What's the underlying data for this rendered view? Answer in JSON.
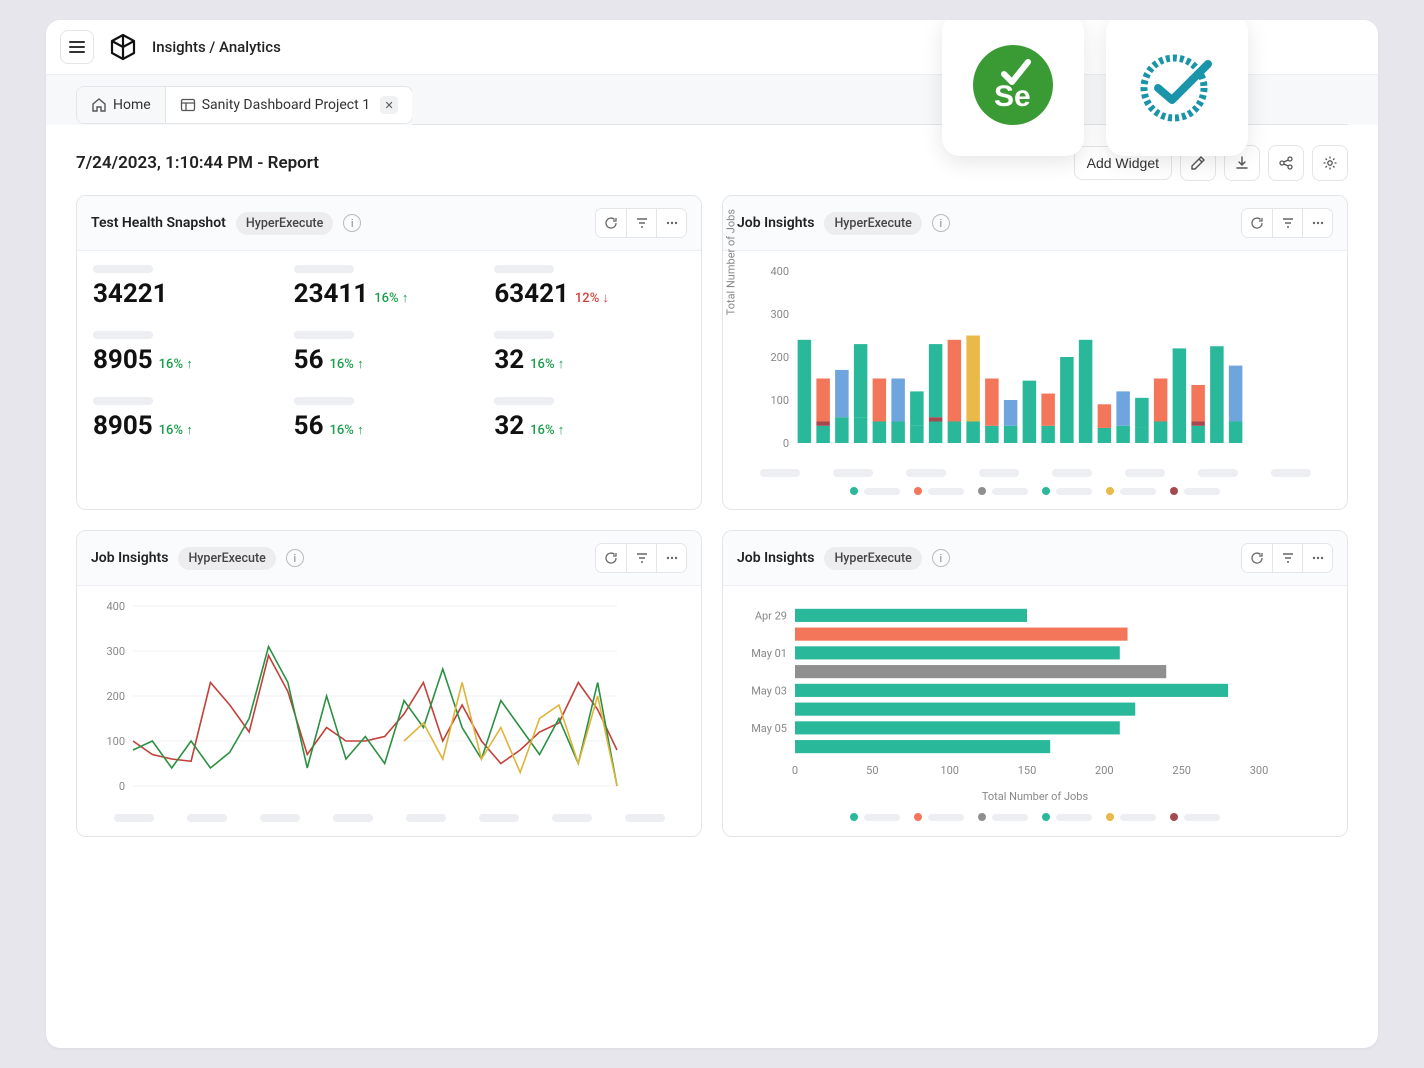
{
  "breadcrumb": "Insights / Analytics",
  "tabs": {
    "home_label": "Home",
    "dashboard_label": "Sanity Dashboard Project 1"
  },
  "title": "7/24/2023, 1:10:44 PM - Report",
  "add_widget_label": "Add Widget",
  "colors": {
    "green": "#29b89a",
    "orange": "#f4765a",
    "blue": "#6fa5de",
    "grey": "#8f8f8f",
    "yellow": "#e9b949",
    "darkred": "#a4494f",
    "line_red": "#c4403a",
    "line_green": "#2a9142",
    "line_yellow": "#e0b43a"
  },
  "cards": {
    "snapshot": {
      "title": "Test Health Snapshot",
      "badge": "HyperExecute",
      "metrics": [
        {
          "value": "34221",
          "delta": "",
          "trend": ""
        },
        {
          "value": "23411",
          "delta": "16%",
          "trend": "up"
        },
        {
          "value": "63421",
          "delta": "12%",
          "trend": "down"
        },
        {
          "value": "8905",
          "delta": "16%",
          "trend": "up"
        },
        {
          "value": "56",
          "delta": "16%",
          "trend": "up"
        },
        {
          "value": "32",
          "delta": "16%",
          "trend": "up"
        },
        {
          "value": "8905",
          "delta": "16%",
          "trend": "up"
        },
        {
          "value": "56",
          "delta": "16%",
          "trend": "up"
        },
        {
          "value": "32",
          "delta": "16%",
          "trend": "up"
        }
      ]
    },
    "insights_bar": {
      "title": "Job Insights",
      "badge": "HyperExecute",
      "ylabel": "Total Number of Jobs"
    },
    "insights_line": {
      "title": "Job Insights",
      "badge": "HyperExecute"
    },
    "insights_hbar": {
      "title": "Job Insights",
      "badge": "HyperExecute",
      "xlabel": "Total Number of Jobs"
    }
  },
  "chart_data": [
    {
      "id": "stacked_bar",
      "type": "bar",
      "stacked": true,
      "ylabel": "Total Number of Jobs",
      "ylim": [
        0,
        400
      ],
      "yticks": [
        0,
        100,
        200,
        300,
        400
      ],
      "groups": [
        {
          "values": [
            50,
            190,
            0,
            0,
            0,
            0
          ],
          "colors": [
            "green",
            "green_top",
            "",
            "",
            "",
            ""
          ],
          "stack": [
            {
              "c": "green",
              "v": 50
            },
            {
              "c": "green_top",
              "v": 190
            }
          ]
        },
        {
          "stack": [
            {
              "c": "green",
              "v": 40
            },
            {
              "c": "darkred",
              "v": 10
            },
            {
              "c": "orange",
              "v": 100
            }
          ]
        },
        {
          "stack": [
            {
              "c": "green",
              "v": 60
            },
            {
              "c": "blue",
              "v": 110
            }
          ]
        },
        {
          "stack": [
            {
              "c": "green",
              "v": 60
            },
            {
              "c": "green_top",
              "v": 170
            }
          ]
        },
        {
          "stack": [
            {
              "c": "green",
              "v": 50
            },
            {
              "c": "orange",
              "v": 100
            }
          ]
        },
        {
          "stack": [
            {
              "c": "green",
              "v": 50
            },
            {
              "c": "blue",
              "v": 100
            }
          ]
        },
        {
          "stack": [
            {
              "c": "green",
              "v": 40
            },
            {
              "c": "green_top",
              "v": 80
            }
          ]
        },
        {
          "stack": [
            {
              "c": "green",
              "v": 50
            },
            {
              "c": "darkred",
              "v": 10
            },
            {
              "c": "green_top",
              "v": 170
            }
          ]
        },
        {
          "stack": [
            {
              "c": "green",
              "v": 50
            },
            {
              "c": "orange",
              "v": 190
            }
          ]
        },
        {
          "stack": [
            {
              "c": "green",
              "v": 50
            },
            {
              "c": "yellow",
              "v": 200
            }
          ]
        },
        {
          "stack": [
            {
              "c": "green",
              "v": 40
            },
            {
              "c": "orange",
              "v": 110
            }
          ]
        },
        {
          "stack": [
            {
              "c": "green",
              "v": 40
            },
            {
              "c": "blue",
              "v": 60
            }
          ]
        },
        {
          "stack": [
            {
              "c": "green",
              "v": 50
            },
            {
              "c": "green_top",
              "v": 95
            }
          ]
        },
        {
          "stack": [
            {
              "c": "green",
              "v": 40
            },
            {
              "c": "orange",
              "v": 75
            }
          ]
        },
        {
          "stack": [
            {
              "c": "green",
              "v": 50
            },
            {
              "c": "green_top",
              "v": 150
            }
          ]
        },
        {
          "stack": [
            {
              "c": "green",
              "v": 50
            },
            {
              "c": "green_top",
              "v": 190
            }
          ]
        },
        {
          "stack": [
            {
              "c": "green",
              "v": 35
            },
            {
              "c": "orange",
              "v": 55
            }
          ]
        },
        {
          "stack": [
            {
              "c": "green",
              "v": 40
            },
            {
              "c": "blue",
              "v": 80
            }
          ]
        },
        {
          "stack": [
            {
              "c": "green",
              "v": 35
            },
            {
              "c": "green_top",
              "v": 70
            }
          ]
        },
        {
          "stack": [
            {
              "c": "green",
              "v": 50
            },
            {
              "c": "orange",
              "v": 100
            }
          ]
        },
        {
          "stack": [
            {
              "c": "green",
              "v": 50
            },
            {
              "c": "green_top",
              "v": 170
            }
          ]
        },
        {
          "stack": [
            {
              "c": "green",
              "v": 40
            },
            {
              "c": "darkred",
              "v": 10
            },
            {
              "c": "orange",
              "v": 85
            }
          ]
        },
        {
          "stack": [
            {
              "c": "green",
              "v": 50
            },
            {
              "c": "green_top",
              "v": 175
            }
          ]
        },
        {
          "stack": [
            {
              "c": "green",
              "v": 50
            },
            {
              "c": "blue",
              "v": 130
            }
          ]
        }
      ],
      "legend_colors": [
        "green",
        "orange",
        "grey",
        "green",
        "yellow",
        "darkred"
      ]
    },
    {
      "id": "line",
      "type": "line",
      "ylim": [
        0,
        400
      ],
      "yticks": [
        0,
        100,
        200,
        300,
        400
      ],
      "series": [
        {
          "color": "line_red",
          "values": [
            100,
            70,
            60,
            55,
            230,
            180,
            120,
            290,
            210,
            70,
            130,
            100,
            100,
            110,
            160,
            230,
            100,
            180,
            100,
            50,
            80,
            120,
            140,
            230,
            170,
            80
          ]
        },
        {
          "color": "line_green",
          "values": [
            80,
            100,
            40,
            100,
            40,
            75,
            150,
            310,
            230,
            40,
            200,
            60,
            110,
            50,
            190,
            130,
            260,
            130,
            60,
            190,
            130,
            70,
            150,
            50,
            230,
            0
          ]
        },
        {
          "color": "line_yellow",
          "start_index": 14,
          "values": [
            100,
            140,
            60,
            230,
            60,
            130,
            30,
            150,
            180,
            50,
            200,
            0
          ]
        }
      ]
    },
    {
      "id": "hbar",
      "type": "bar",
      "orientation": "h",
      "xlim": [
        0,
        300
      ],
      "xticks": [
        0,
        50,
        100,
        150,
        200,
        250,
        300
      ],
      "xlabel": "Total Number of Jobs",
      "ylabels": [
        "Apr 29",
        "",
        "May 01",
        "",
        "May 03",
        "",
        "May 05"
      ],
      "bars": [
        {
          "value": 150,
          "color": "green"
        },
        {
          "value": 215,
          "color": "orange"
        },
        {
          "value": 210,
          "color": "green"
        },
        {
          "value": 240,
          "color": "grey"
        },
        {
          "value": 280,
          "color": "green"
        },
        {
          "value": 220,
          "color": "green"
        },
        {
          "value": 210,
          "color": "green"
        },
        {
          "value": 165,
          "color": "green"
        }
      ],
      "legend_colors": [
        "green",
        "orange",
        "grey",
        "green",
        "yellow",
        "darkred"
      ]
    }
  ]
}
